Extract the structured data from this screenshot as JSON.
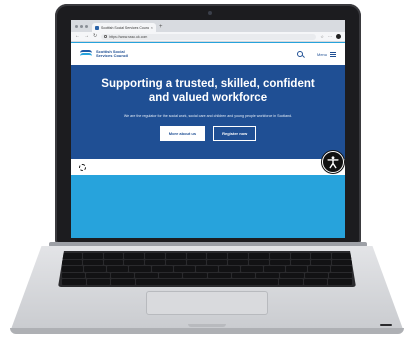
{
  "browser": {
    "tab_title": "Scottish Social Services Council",
    "tab_close": "×",
    "new_tab": "+",
    "url": "https://www.sssc.uk.com",
    "nav_back": "←",
    "nav_forward": "→",
    "nav_reload": "↻"
  },
  "site": {
    "logo_line1": "Scottish Social",
    "logo_line2": "Services Council",
    "menu_label": "Menu"
  },
  "hero": {
    "title": "Supporting a trusted, skilled, confident and valued workforce",
    "subtitle": "We are the regulator for the social work, social care and children and young people workforce in Scotland.",
    "buttons": [
      "More about us",
      "Register now"
    ]
  },
  "colors": {
    "brand_navy": "#1f4f94",
    "brand_sky": "#27a3dc"
  },
  "icons": [
    "search-icon",
    "menu-icon",
    "gear-icon",
    "accessibility-icon"
  ]
}
